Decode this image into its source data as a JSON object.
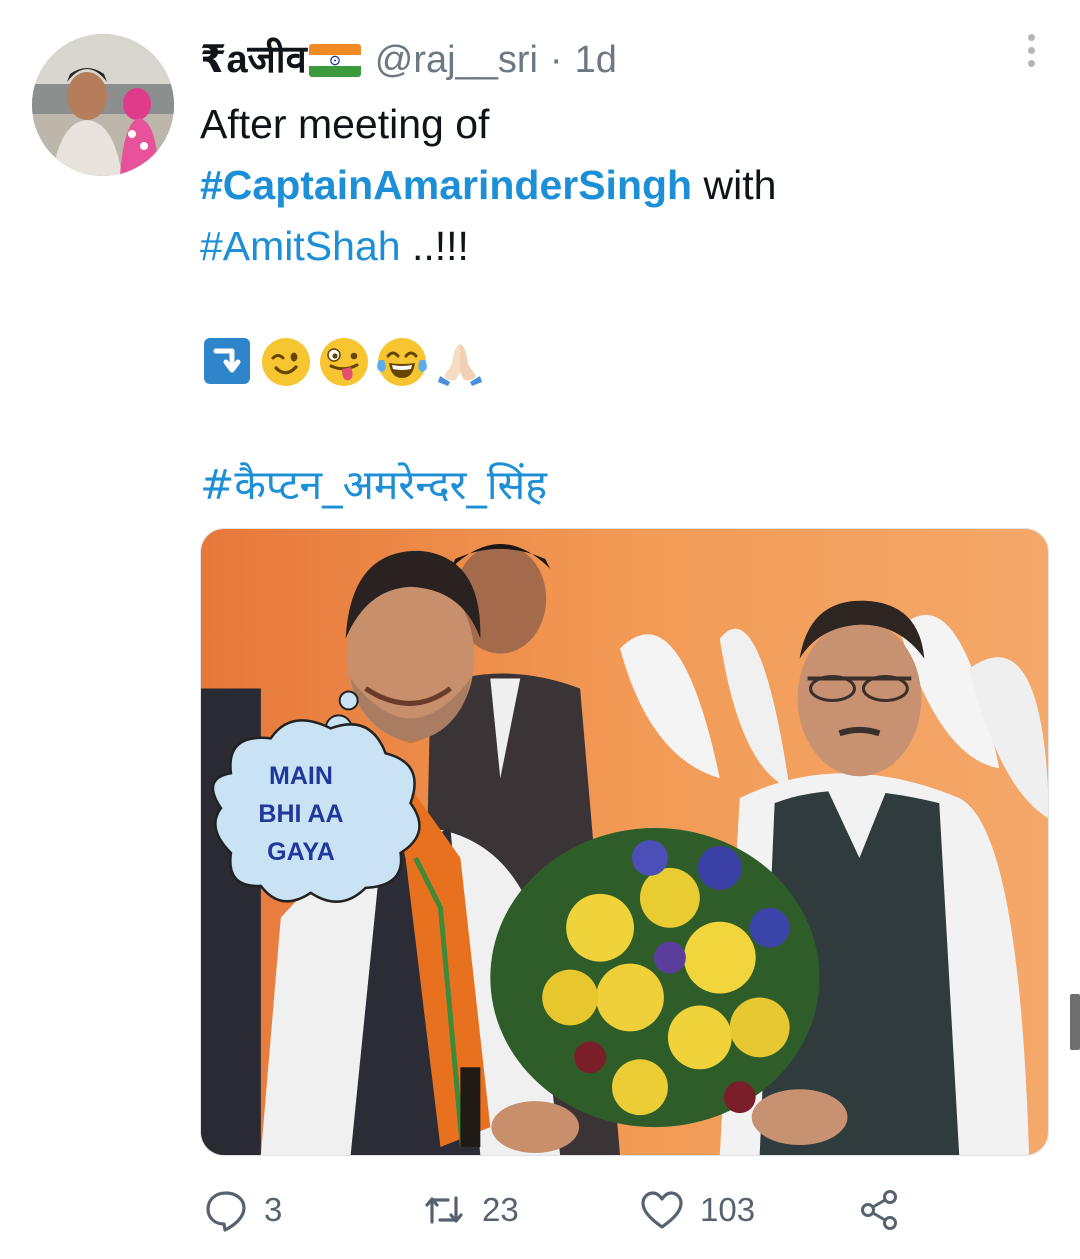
{
  "tweet": {
    "author_name": "₹aजीव",
    "handle": "@raj__sri",
    "separator": "·",
    "time": "1d",
    "text_lines": [
      {
        "plain": "After meeting of"
      },
      {
        "hashtag": "#CaptainAmarinderSingh",
        "plain": " with"
      },
      {
        "hashtag": "#AmitShah",
        "plain": " ..!!!"
      }
    ],
    "hindi_hashtag": "#कैप्टन_अमरेन्दर_सिंह",
    "emojis": [
      "arrow-down-right-icon",
      "winking-face-icon",
      "zany-face-icon",
      "tears-of-joy-icon",
      "folded-hands-icon"
    ]
  },
  "media": {
    "bubble_lines": [
      "MAIN",
      "BHI AA",
      "GAYA"
    ]
  },
  "actions": {
    "replies": "3",
    "retweets": "23",
    "likes": "103"
  },
  "colors": {
    "link": "#1d8fd6",
    "muted": "#56636f",
    "bubble_text": "#20379b"
  }
}
